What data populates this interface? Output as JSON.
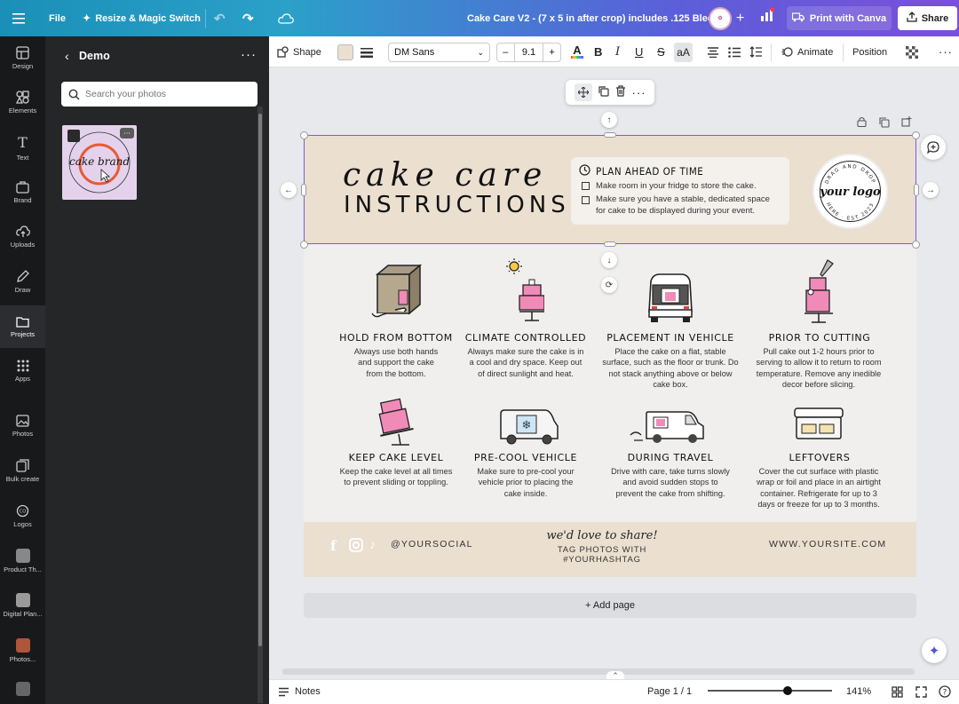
{
  "topbar": {
    "file_label": "File",
    "resize_label": "Resize & Magic Switch",
    "doc_title": "Cake Care V2 - (7 x 5 in after crop) includes .125 Bleed",
    "print_label": "Print with Canva",
    "share_label": "Share",
    "colors": {
      "gradient_start": "#1a8fb8",
      "gradient_end": "#7a4fd9"
    }
  },
  "rail": {
    "items": [
      {
        "label": "Design",
        "icon": "layout-icon"
      },
      {
        "label": "Elements",
        "icon": "shapes-icon"
      },
      {
        "label": "Text",
        "icon": "text-icon"
      },
      {
        "label": "Brand",
        "icon": "brand-icon"
      },
      {
        "label": "Uploads",
        "icon": "cloud-upload-icon"
      },
      {
        "label": "Draw",
        "icon": "pen-icon"
      },
      {
        "label": "Projects",
        "icon": "folder-icon"
      },
      {
        "label": "Apps",
        "icon": "apps-grid-icon"
      },
      {
        "label": "Photos",
        "icon": "photo-icon"
      },
      {
        "label": "Bulk create",
        "icon": "bulk-create-icon"
      },
      {
        "label": "Logos",
        "icon": "logos-icon"
      },
      {
        "label": "Product Th...",
        "icon": "app-thumbnail"
      },
      {
        "label": "Digital Plan...",
        "icon": "app-thumbnail"
      },
      {
        "label": "Photos...",
        "icon": "app-thumbnail"
      }
    ],
    "active_index": 6
  },
  "panel": {
    "title": "Demo",
    "search_placeholder": "Search your photos",
    "thumb_text": "cake brand"
  },
  "toolbar": {
    "shape_label": "Shape",
    "fill_color": "#ebdfd0",
    "font_name": "DM Sans",
    "font_size": "9.1",
    "minus": "–",
    "plus": "+",
    "animate_label": "Animate",
    "position_label": "Position"
  },
  "design": {
    "title_script": "cake care",
    "title_caps": "INSTRUCTIONS",
    "plan": {
      "title": "PLAN AHEAD OF TIME",
      "items": [
        "Make room in your fridge to store the cake.",
        "Make sure you have a  stable, dedicated space",
        "for cake to be displayed during your event."
      ]
    },
    "logo": {
      "text": "your logo",
      "ring_top": "DRAG AND DROP",
      "ring_bottom": "HERE · EST 2023"
    },
    "cards": [
      {
        "title": "HOLD FROM BOTTOM",
        "lines": [
          "Always use both hands",
          "and support the cake",
          "from the bottom."
        ]
      },
      {
        "title": "CLIMATE CONTROLLED",
        "lines": [
          "Always make sure the cake is in",
          "a cool and dry space. Keep out",
          "of direct sunlight and heat."
        ]
      },
      {
        "title": "PLACEMENT IN VEHICLE",
        "lines": [
          "Place the cake on a flat, stable",
          "surface, such as the floor or trunk. Do",
          "not stack anything above or below",
          "cake box."
        ]
      },
      {
        "title": "PRIOR TO CUTTING",
        "lines": [
          "Pull cake out 1-2 hours prior to",
          "serving to allow it to return to room",
          "temperature. Remove any inedible",
          "decor before slicing."
        ]
      },
      {
        "title": "KEEP CAKE LEVEL",
        "lines": [
          "Keep the cake level at all times",
          "to prevent sliding or toppling."
        ]
      },
      {
        "title": "PRE-COOL VEHICLE",
        "lines": [
          "Make sure to pre-cool your",
          "vehicle prior to placing the",
          "cake inside."
        ]
      },
      {
        "title": "DURING TRAVEL",
        "lines": [
          "Drive with care, take turns slowly",
          "and avoid sudden stops to",
          "prevent the cake from shifting."
        ]
      },
      {
        "title": "LEFTOVERS",
        "lines": [
          "Cover the cut surface with plastic",
          "wrap or foil and place in an airtight",
          "container. Refrigerate for up to 3",
          "days or freeze for up to 3 months."
        ]
      }
    ],
    "footer": {
      "social": "@YOURSOCIAL",
      "script": "we'd love to share!",
      "hashtag": "TAG PHOTOS WITH #YOURHASHTAG",
      "site": "WWW.YOURSITE.COM"
    },
    "colors": {
      "beige": "#ebdfd0",
      "pink": "#f08bb8",
      "selection": "#7d5bd6"
    }
  },
  "canvas": {
    "add_page": "+ Add page"
  },
  "bottombar": {
    "notes_label": "Notes",
    "page_label": "Page 1 / 1",
    "zoom": "141%",
    "zoom_fraction": 0.64
  }
}
